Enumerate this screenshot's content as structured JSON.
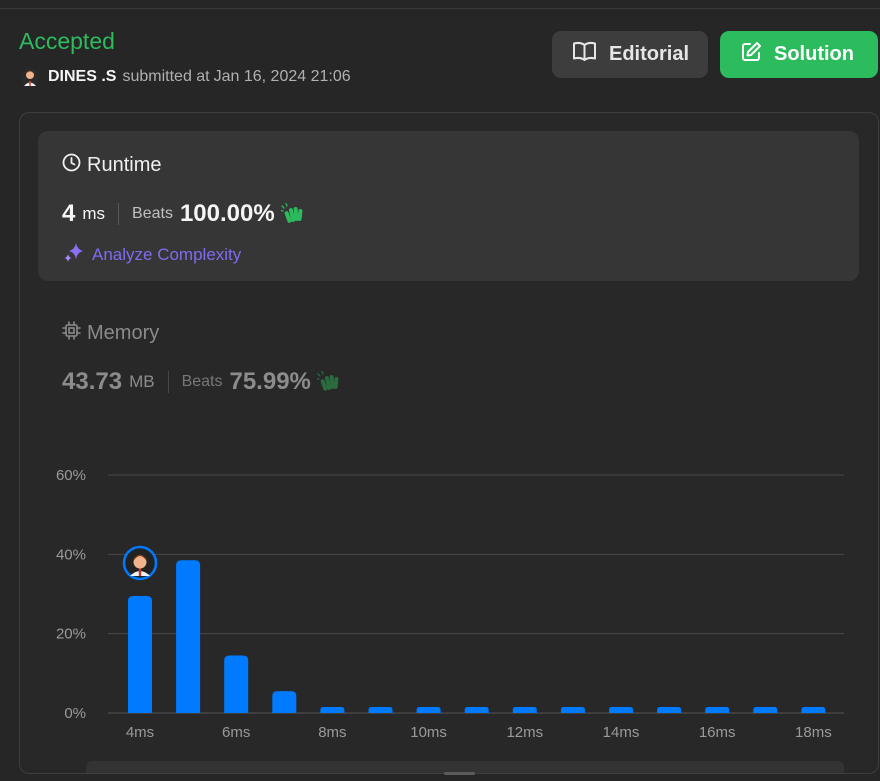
{
  "header": {
    "status": "Accepted",
    "username": "DINES .S",
    "submitted_text": "submitted at",
    "timestamp": "Jan 16, 2024 21:06"
  },
  "buttons": {
    "editorial": "Editorial",
    "solution": "Solution"
  },
  "runtime": {
    "title": "Runtime",
    "value": "4",
    "unit": "ms",
    "beats_label": "Beats",
    "beats_value": "100.00%",
    "analyze": "Analyze Complexity"
  },
  "memory": {
    "title": "Memory",
    "value": "43.73",
    "unit": "MB",
    "beats_label": "Beats",
    "beats_value": "75.99%"
  },
  "colors": {
    "accepted": "#2cbb5d",
    "bar": "#007aff",
    "analyze": "#7e6cf0"
  },
  "chart_data": {
    "type": "bar",
    "x_labels": [
      "4ms",
      "",
      "6ms",
      "",
      "8ms",
      "",
      "10ms",
      "",
      "12ms",
      "",
      "14ms",
      "",
      "16ms",
      "",
      "18ms"
    ],
    "values": [
      29.5,
      38.5,
      14.5,
      5.5,
      1.5,
      1.5,
      1.5,
      1.5,
      1.5,
      1.5,
      1.5,
      1.5,
      1.5,
      1.5,
      1.5
    ],
    "y_ticks": [
      "0%",
      "20%",
      "40%",
      "60%"
    ],
    "ylim": [
      0,
      60
    ],
    "highlight_index": 0,
    "grid": true
  }
}
